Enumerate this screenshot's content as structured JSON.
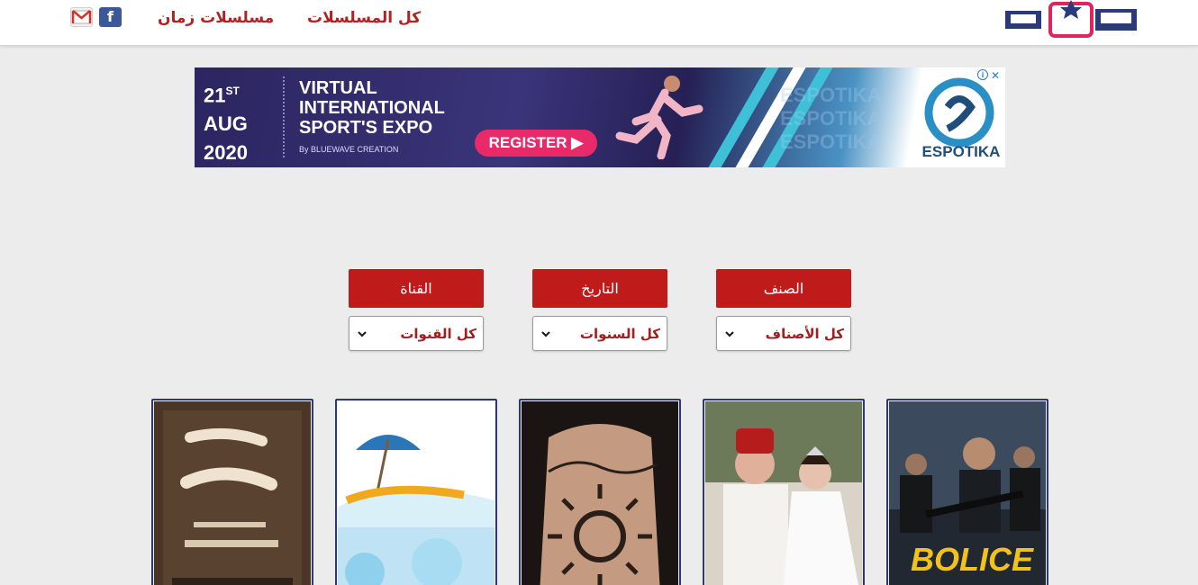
{
  "header": {
    "nav": [
      {
        "label": "كل المسلسلات"
      },
      {
        "label": "مسلسلات زمان"
      }
    ],
    "facebook_glyph": "f",
    "logo_icon": "tv-logo-icon",
    "social_icons": [
      "facebook-icon",
      "gmail-icon"
    ]
  },
  "ad": {
    "date_day": "21",
    "date_suffix": "ST",
    "date_month": "AUG",
    "date_year": "2020",
    "title_line1": "VIRTUAL",
    "title_line2": "INTERNATIONAL",
    "title_line3": "SPORT'S EXPO",
    "sub": "By BLUEWAVE CREATION",
    "register": "REGISTER",
    "ghost_text": "ESPOTIKA",
    "brand": "ESPOTIKA",
    "close_glyph": "✕",
    "info_glyph": "i"
  },
  "filters": [
    {
      "label": "الصنف",
      "value": "كل الأصناف"
    },
    {
      "label": "التاريخ",
      "value": "كل السنوات"
    },
    {
      "label": "القناة",
      "value": "كل القنوات"
    }
  ],
  "posters": [
    {
      "name": "poster-bolice",
      "text": "BOLICE"
    },
    {
      "name": "poster-wedding"
    },
    {
      "name": "poster-tattoo"
    },
    {
      "name": "poster-beach"
    },
    {
      "name": "poster-donia-okhra"
    }
  ],
  "colors": {
    "accent": "#c01b1b",
    "nav_text": "#b32121",
    "poster_border": "#2e3a6e",
    "background": "#ececec"
  }
}
